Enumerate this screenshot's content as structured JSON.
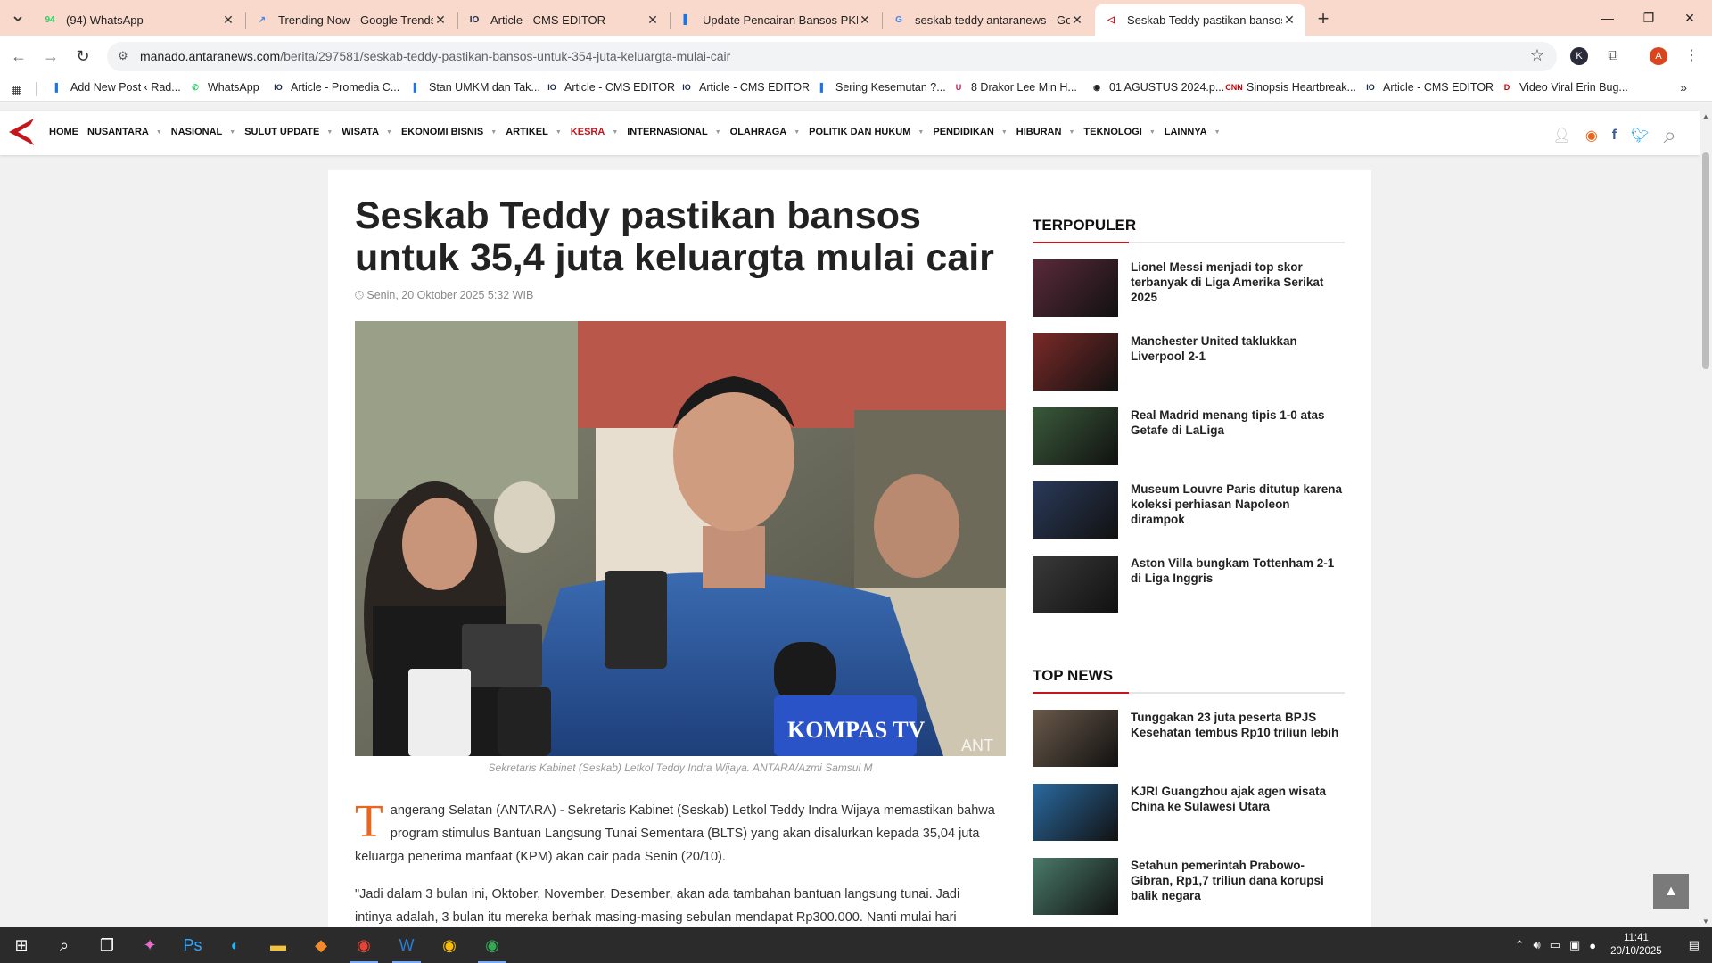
{
  "browser": {
    "tabs": [
      {
        "title": "(94) WhatsApp",
        "icon": "whatsapp-icon",
        "fav_text": "94",
        "fav_color": "#25d366"
      },
      {
        "title": "Trending Now - Google Trends",
        "icon": "trends-icon",
        "fav_text": "↗",
        "fav_color": "#4285f4"
      },
      {
        "title": "Article - CMS EDITOR",
        "icon": "cms-icon",
        "fav_text": "IO",
        "fav_color": "#1a2a4a"
      },
      {
        "title": "Update Pencairan Bansos PKH B",
        "icon": "docs-icon",
        "fav_text": "▌",
        "fav_color": "#1a73e8"
      },
      {
        "title": "seskab teddy antaranews - Goo",
        "icon": "google-icon",
        "fav_text": "G",
        "fav_color": "#4285f4"
      },
      {
        "title": "Seskab Teddy pastikan bansos u",
        "icon": "antara-icon",
        "fav_text": "◁",
        "fav_color": "#c4161c"
      }
    ],
    "new_tab": "+",
    "url_domain": "manado.antaranews.com",
    "url_path": "/berita/297581/seskab-teddy-pastikan-bansos-untuk-354-juta-keluargta-mulai-cair",
    "profile_k": "K",
    "profile_a": "A"
  },
  "bookmarks": [
    {
      "label": "Add New Post ‹ Rad...",
      "fav_text": "▌",
      "fav_color": "#1a73e8"
    },
    {
      "label": "WhatsApp",
      "fav_text": "✆",
      "fav_color": "#25d366"
    },
    {
      "label": "Article - Promedia C...",
      "fav_text": "IO",
      "fav_color": "#1a2a4a"
    },
    {
      "label": "Stan UMKM dan Tak...",
      "fav_text": "▌",
      "fav_color": "#1a73e8"
    },
    {
      "label": "Article - CMS EDITOR",
      "fav_text": "IO",
      "fav_color": "#1a2a4a"
    },
    {
      "label": "Article - CMS EDITOR",
      "fav_text": "IO",
      "fav_color": "#1a2a4a"
    },
    {
      "label": "Sering Kesemutan ?...",
      "fav_text": "▌",
      "fav_color": "#1a73e8"
    },
    {
      "label": "8 Drakor Lee Min H...",
      "fav_text": "U",
      "fav_color": "#c2185b"
    },
    {
      "label": "01 AGUSTUS 2024.p...",
      "fav_text": "◉",
      "fav_color": "#222222"
    },
    {
      "label": "Sinopsis Heartbreak...",
      "fav_text": "CNN",
      "fav_color": "#cc0000"
    },
    {
      "label": "Article - CMS EDITOR",
      "fav_text": "IO",
      "fav_color": "#1a2a4a"
    },
    {
      "label": "Video Viral Erin Bug...",
      "fav_text": "D",
      "fav_color": "#cc0000"
    }
  ],
  "site": {
    "menu": [
      "HOME",
      "NUSANTARA",
      "NASIONAL",
      "SULUT UPDATE",
      "WISATA",
      "EKONOMI BISNIS",
      "ARTIKEL",
      "KESRA",
      "INTERNASIONAL",
      "OLAHRAGA",
      "POLITIK DAN HUKUM",
      "PENDIDIKAN",
      "HIBURAN",
      "TEKNOLOGI",
      "LAINNYA"
    ],
    "menu_selected": "KESRA",
    "accent": "#c4161c"
  },
  "article": {
    "title": "Seskab Teddy pastikan bansos untuk 35,4 juta keluargta mulai cair",
    "date": "Senin, 20 Oktober 2025 5:32 WIB",
    "photo_watermark": "KOMPAS TV",
    "photo_corner": "ANT",
    "caption": "Sekretaris Kabinet (Seskab) Letkol Teddy Indra Wijaya. ANTARA/Azmi Samsul M",
    "dropcap": "T",
    "para1": "angerang Selatan (ANTARA) - Sekretaris Kabinet (Seskab) Letkol Teddy Indra Wijaya memastikan bahwa program stimulus Bantuan Langsung Tunai Sementara (BLTS) yang akan disalurkan kepada 35,04 juta keluarga penerima manfaat (KPM) akan cair pada Senin (20/10).",
    "para2": "\"Jadi dalam 3 bulan ini, Oktober, November, Desember, akan ada tambahan bantuan langsung tunai. Jadi intinya adalah, 3 bulan itu mereka berhak masing-masing sebulan mendapat Rp300.000. Nanti mulai hari"
  },
  "sidebar": {
    "popular_title": "TERPOPULER",
    "popular": [
      {
        "text": "Lionel Messi menjadi top skor terbanyak di Liga Amerika Serikat 2025",
        "thumb": "#5a2a3a"
      },
      {
        "text": "Manchester United taklukkan Liverpool 2-1",
        "thumb": "#7a2a28"
      },
      {
        "text": "Real Madrid menang tipis 1-0 atas Getafe di LaLiga",
        "thumb": "#3a5a3a"
      },
      {
        "text": "Museum Louvre Paris ditutup karena koleksi perhiasan Napoleon dirampok",
        "thumb": "#2a3a5a"
      },
      {
        "text": "Aston Villa bungkam Tottenham 2-1 di Liga Inggris",
        "thumb": "#3a3a3a"
      }
    ],
    "news_title": "TOP NEWS",
    "news": [
      {
        "text": "Tunggakan 23 juta peserta BPJS Kesehatan tembus Rp10 triliun lebih",
        "thumb": "#6a5a4a"
      },
      {
        "text": "KJRI Guangzhou ajak agen wisata China ke Sulawesi Utara",
        "thumb": "#2a6aa0"
      },
      {
        "text": "Setahun pemerintah Prabowo-Gibran, Rp1,7 triliun dana korupsi balik negara",
        "thumb": "#4a7a6a"
      }
    ]
  },
  "taskbar": {
    "time": "11:41",
    "date": "20/10/2025"
  }
}
